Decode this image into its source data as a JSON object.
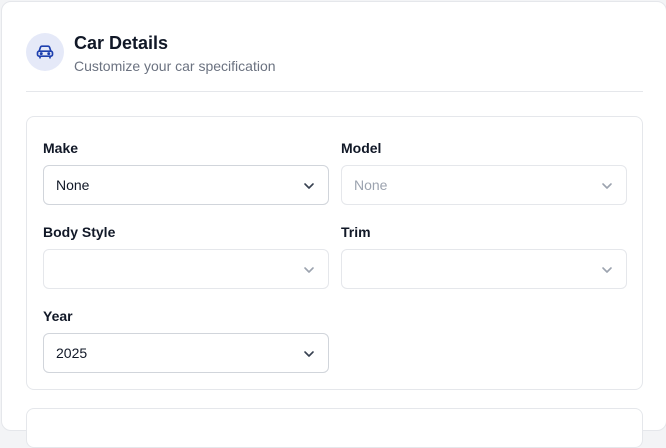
{
  "header": {
    "title": "Car Details",
    "subtitle": "Customize your car specification",
    "icon": "car-icon",
    "accent_color": "#1e40af"
  },
  "fields": {
    "make": {
      "label": "Make",
      "value": "None",
      "disabled": false
    },
    "model": {
      "label": "Model",
      "value": "None",
      "disabled": true
    },
    "body_style": {
      "label": "Body Style",
      "value": "",
      "disabled": true
    },
    "trim": {
      "label": "Trim",
      "value": "",
      "disabled": true
    },
    "year": {
      "label": "Year",
      "value": "2025",
      "disabled": false
    }
  }
}
